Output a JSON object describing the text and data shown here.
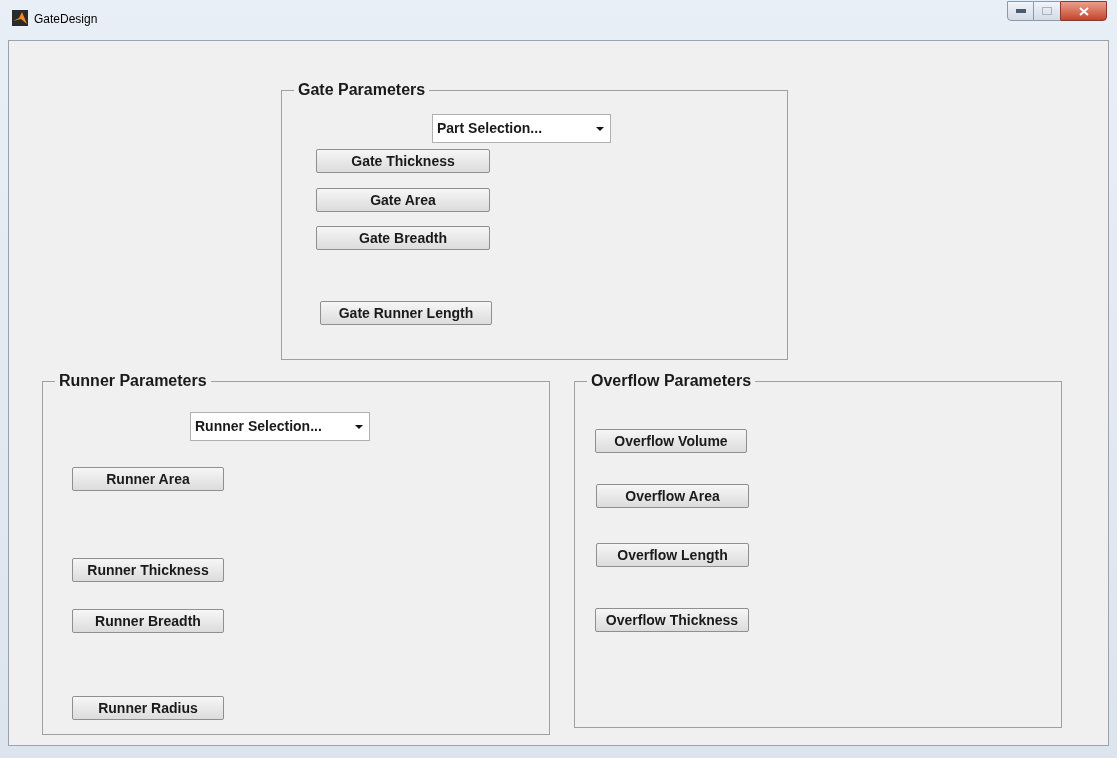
{
  "window": {
    "title": "GateDesign"
  },
  "groups": [
    {
      "title": "Gate Parameters",
      "dropdown": {
        "value": "Part Selection..."
      },
      "buttons": [
        "Gate Thickness",
        "Gate Area",
        "Gate Breadth",
        "Gate Runner Length"
      ]
    },
    {
      "title": "Runner Parameters",
      "dropdown": {
        "value": "Runner Selection..."
      },
      "buttons": [
        "Runner Area",
        "Runner Thickness",
        "Runner Breadth",
        "Runner Radius"
      ]
    },
    {
      "title": "Overflow Parameters",
      "buttons": [
        "Overflow Volume",
        "Overflow Area",
        "Overflow Length",
        "Overflow Thickness"
      ]
    }
  ]
}
